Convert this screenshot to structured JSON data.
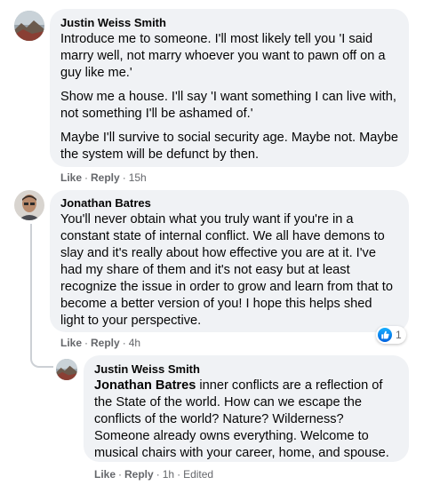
{
  "colors": {
    "bubble_bg": "#f0f2f5",
    "meta_text": "#65676b",
    "like_blue": "#1877f2"
  },
  "comments": [
    {
      "author": "Justin Weiss Smith",
      "paragraphs": [
        "Introduce me to someone. I'll most likely tell you 'I said marry well, not marry whoever you want to pawn off on a guy like me.'",
        "Show me a house. I'll say 'I want something I can live with, not something I'll be ashamed of.'",
        "Maybe I'll survive to social security age. Maybe not. Maybe the system will be defunct by then."
      ],
      "actions": {
        "like": "Like",
        "reply": "Reply",
        "time": "15h"
      }
    },
    {
      "author": "Jonathan Batres",
      "paragraphs": [
        "You'll never obtain what you truly want if you're in a constant state of internal conflict. We all have demons to slay and it's really about how effective you are at it. I've had my share of them and it's not easy but at least recognize the issue in order to grow and learn from that to become a better version of you! I hope this helps shed light to your perspective."
      ],
      "actions": {
        "like": "Like",
        "reply": "Reply",
        "time": "4h"
      },
      "reactions": {
        "icon": "like-icon",
        "count": "1"
      }
    },
    {
      "author": "Justin Weiss Smith",
      "mention": "Jonathan Batres",
      "text": " inner conflicts are a reflection of the State of the world. How can we escape the conflicts of the world? Nature? Wilderness? Someone already owns everything. Welcome to musical chairs with your career, home, and spouse.",
      "actions": {
        "like": "Like",
        "reply": "Reply",
        "time": "1h",
        "edited": "Edited"
      }
    }
  ]
}
